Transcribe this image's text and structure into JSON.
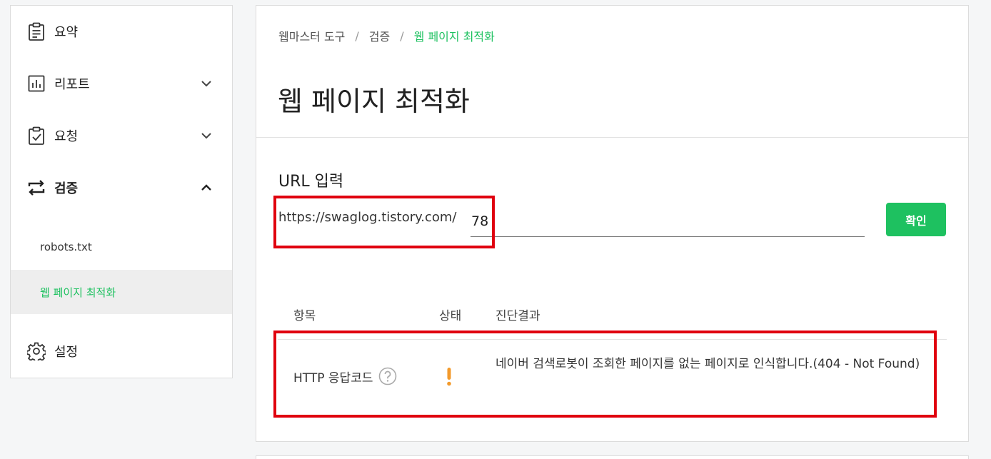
{
  "sidebar": {
    "items": [
      {
        "label": "요약",
        "icon": "clipboard-list-icon"
      },
      {
        "label": "리포트",
        "icon": "bar-chart-icon"
      },
      {
        "label": "요청",
        "icon": "clipboard-check-icon"
      },
      {
        "label": "검증",
        "icon": "swap-arrows-icon"
      },
      {
        "label": "설정",
        "icon": "gear-icon"
      }
    ],
    "sub_items": [
      {
        "label": "robots.txt"
      },
      {
        "label": "웹 페이지 최적화"
      }
    ]
  },
  "breadcrumb": {
    "items": [
      "웹마스터 도구",
      "검증",
      "웹 페이지 최적화"
    ],
    "separator": "/"
  },
  "page": {
    "title": "웹 페이지 최적화"
  },
  "url_section": {
    "label": "URL 입력",
    "prefix": "https://swaglog.tistory.com/",
    "value": "78",
    "button_label": "확인"
  },
  "table": {
    "headers": [
      "항목",
      "상태",
      "진단결과"
    ],
    "rows": [
      {
        "item": "HTTP 응답코드",
        "status": "warning",
        "result": "네이버 검색로봇이 조회한 페이지를 없는 페이지로 인식합니다.(404 - Not Found)"
      }
    ]
  },
  "colors": {
    "accent": "#1ec160",
    "warning": "#f39a2b",
    "highlight": "#e0000e"
  }
}
